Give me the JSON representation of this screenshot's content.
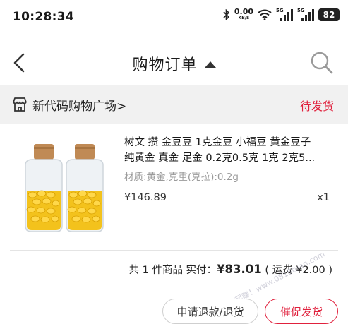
{
  "status_bar": {
    "time": "10:28:34",
    "net_speed": "0.00",
    "net_speed_unit": "KB/S",
    "signal_1_label": "5G",
    "signal_2_label": "5G",
    "battery": "82",
    "icons": [
      "bluetooth-icon",
      "wifi-icon",
      "signal-icon",
      "battery-icon"
    ]
  },
  "nav": {
    "title": "购物订单",
    "icons": [
      "back-arrow-icon",
      "caret-up-icon",
      "search-icon"
    ]
  },
  "store": {
    "name": "新代码购物广场>",
    "status": "待发货",
    "status_color": "#e0213d",
    "icon": "store-icon"
  },
  "product": {
    "title_line1": "树文 攒 金豆豆 1克金豆 小福豆 黄金豆子",
    "title_line2": "纯黄金 真金 足金 0.2克0.5克 1克 2克5...",
    "spec": "材质:黄金,克重(克拉):0.2g",
    "price": "¥146.89",
    "quantity": "x1",
    "image": "gold-beans-jars-image"
  },
  "summary": {
    "count_text": "共 1 件商品 实付：",
    "amount": "¥83.01",
    "shipping": "( 运费 ¥2.00 )"
  },
  "actions": {
    "refund_label": "申请退款/退货",
    "urge_label": "催促发货"
  },
  "watermark": "有奖一起赚！www.0818tuan.com",
  "colors": {
    "accent": "#e0213d",
    "store_header_bg": "#f1f1f1",
    "muted_text": "#9a9a9a"
  }
}
